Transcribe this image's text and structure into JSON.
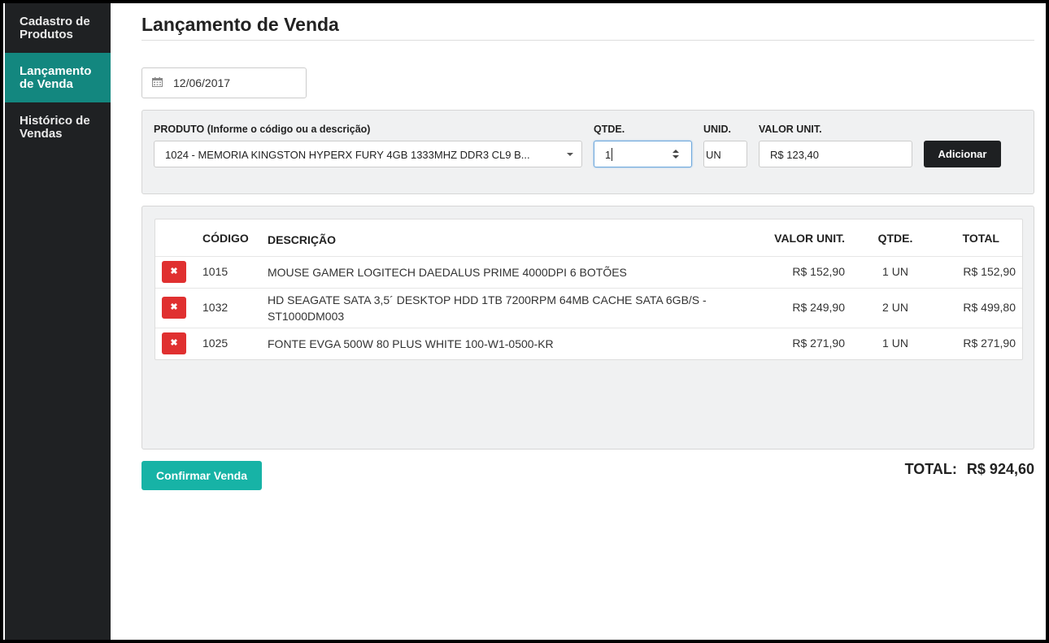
{
  "sidebar": {
    "items": [
      {
        "label_line1": "Cadastro de",
        "label_line2": "Produtos",
        "active": false
      },
      {
        "label_line1": "Lançamento",
        "label_line2": "de Venda",
        "active": true
      },
      {
        "label_line1": "Histórico de",
        "label_line2": "Vendas",
        "active": false
      }
    ]
  },
  "page": {
    "title": "Lançamento de Venda",
    "date_value": "12/06/2017"
  },
  "form": {
    "product_label": "PRODUTO (Informe o código ou a descrição)",
    "product_value": "1024 - MEMORIA KINGSTON HYPERX FURY 4GB 1333MHZ DDR3 CL9 B...",
    "qty_label": "QTDE.",
    "qty_value": "1",
    "unit_label": "UNID.",
    "unit_value": "UN",
    "price_label": "VALOR UNIT.",
    "price_value": "R$ 123,40",
    "add_label": "Adicionar"
  },
  "table": {
    "headers": {
      "code": "CÓDIGO",
      "desc": "DESCRIÇÃO",
      "unit": "VALOR UNIT.",
      "qty": "QTDE.",
      "total": "TOTAL"
    },
    "delete_symbol": "✖",
    "rows": [
      {
        "code": "1015",
        "desc": "MOUSE GAMER LOGITECH DAEDALUS PRIME 4000DPI 6 BOTÕES",
        "unit": "R$ 152,90",
        "qty": "1 UN",
        "total": "R$ 152,90"
      },
      {
        "code": "1032",
        "desc": "HD SEAGATE SATA 3,5´ DESKTOP HDD 1TB 7200RPM 64MB CACHE SATA 6GB/S - ST1000DM003",
        "unit": "R$ 249,90",
        "qty": "2 UN",
        "total": "R$ 499,80"
      },
      {
        "code": "1025",
        "desc": "FONTE EVGA 500W 80 PLUS WHITE 100-W1-0500-KR",
        "unit": "R$ 271,90",
        "qty": "1 UN",
        "total": "R$ 271,90"
      }
    ]
  },
  "footer": {
    "confirm_label": "Confirmar Venda",
    "total_label": "TOTAL:",
    "total_value": "R$ 924,60"
  },
  "colors": {
    "sidebar_bg": "#1f2123",
    "sidebar_active": "#13877f",
    "confirm_button": "#17b3a6",
    "delete_button": "#e03030",
    "add_button": "#1e2022"
  },
  "icons": [
    "calendar-icon",
    "chevron-down-icon",
    "spinner-arrows-icon",
    "delete-icon"
  ]
}
